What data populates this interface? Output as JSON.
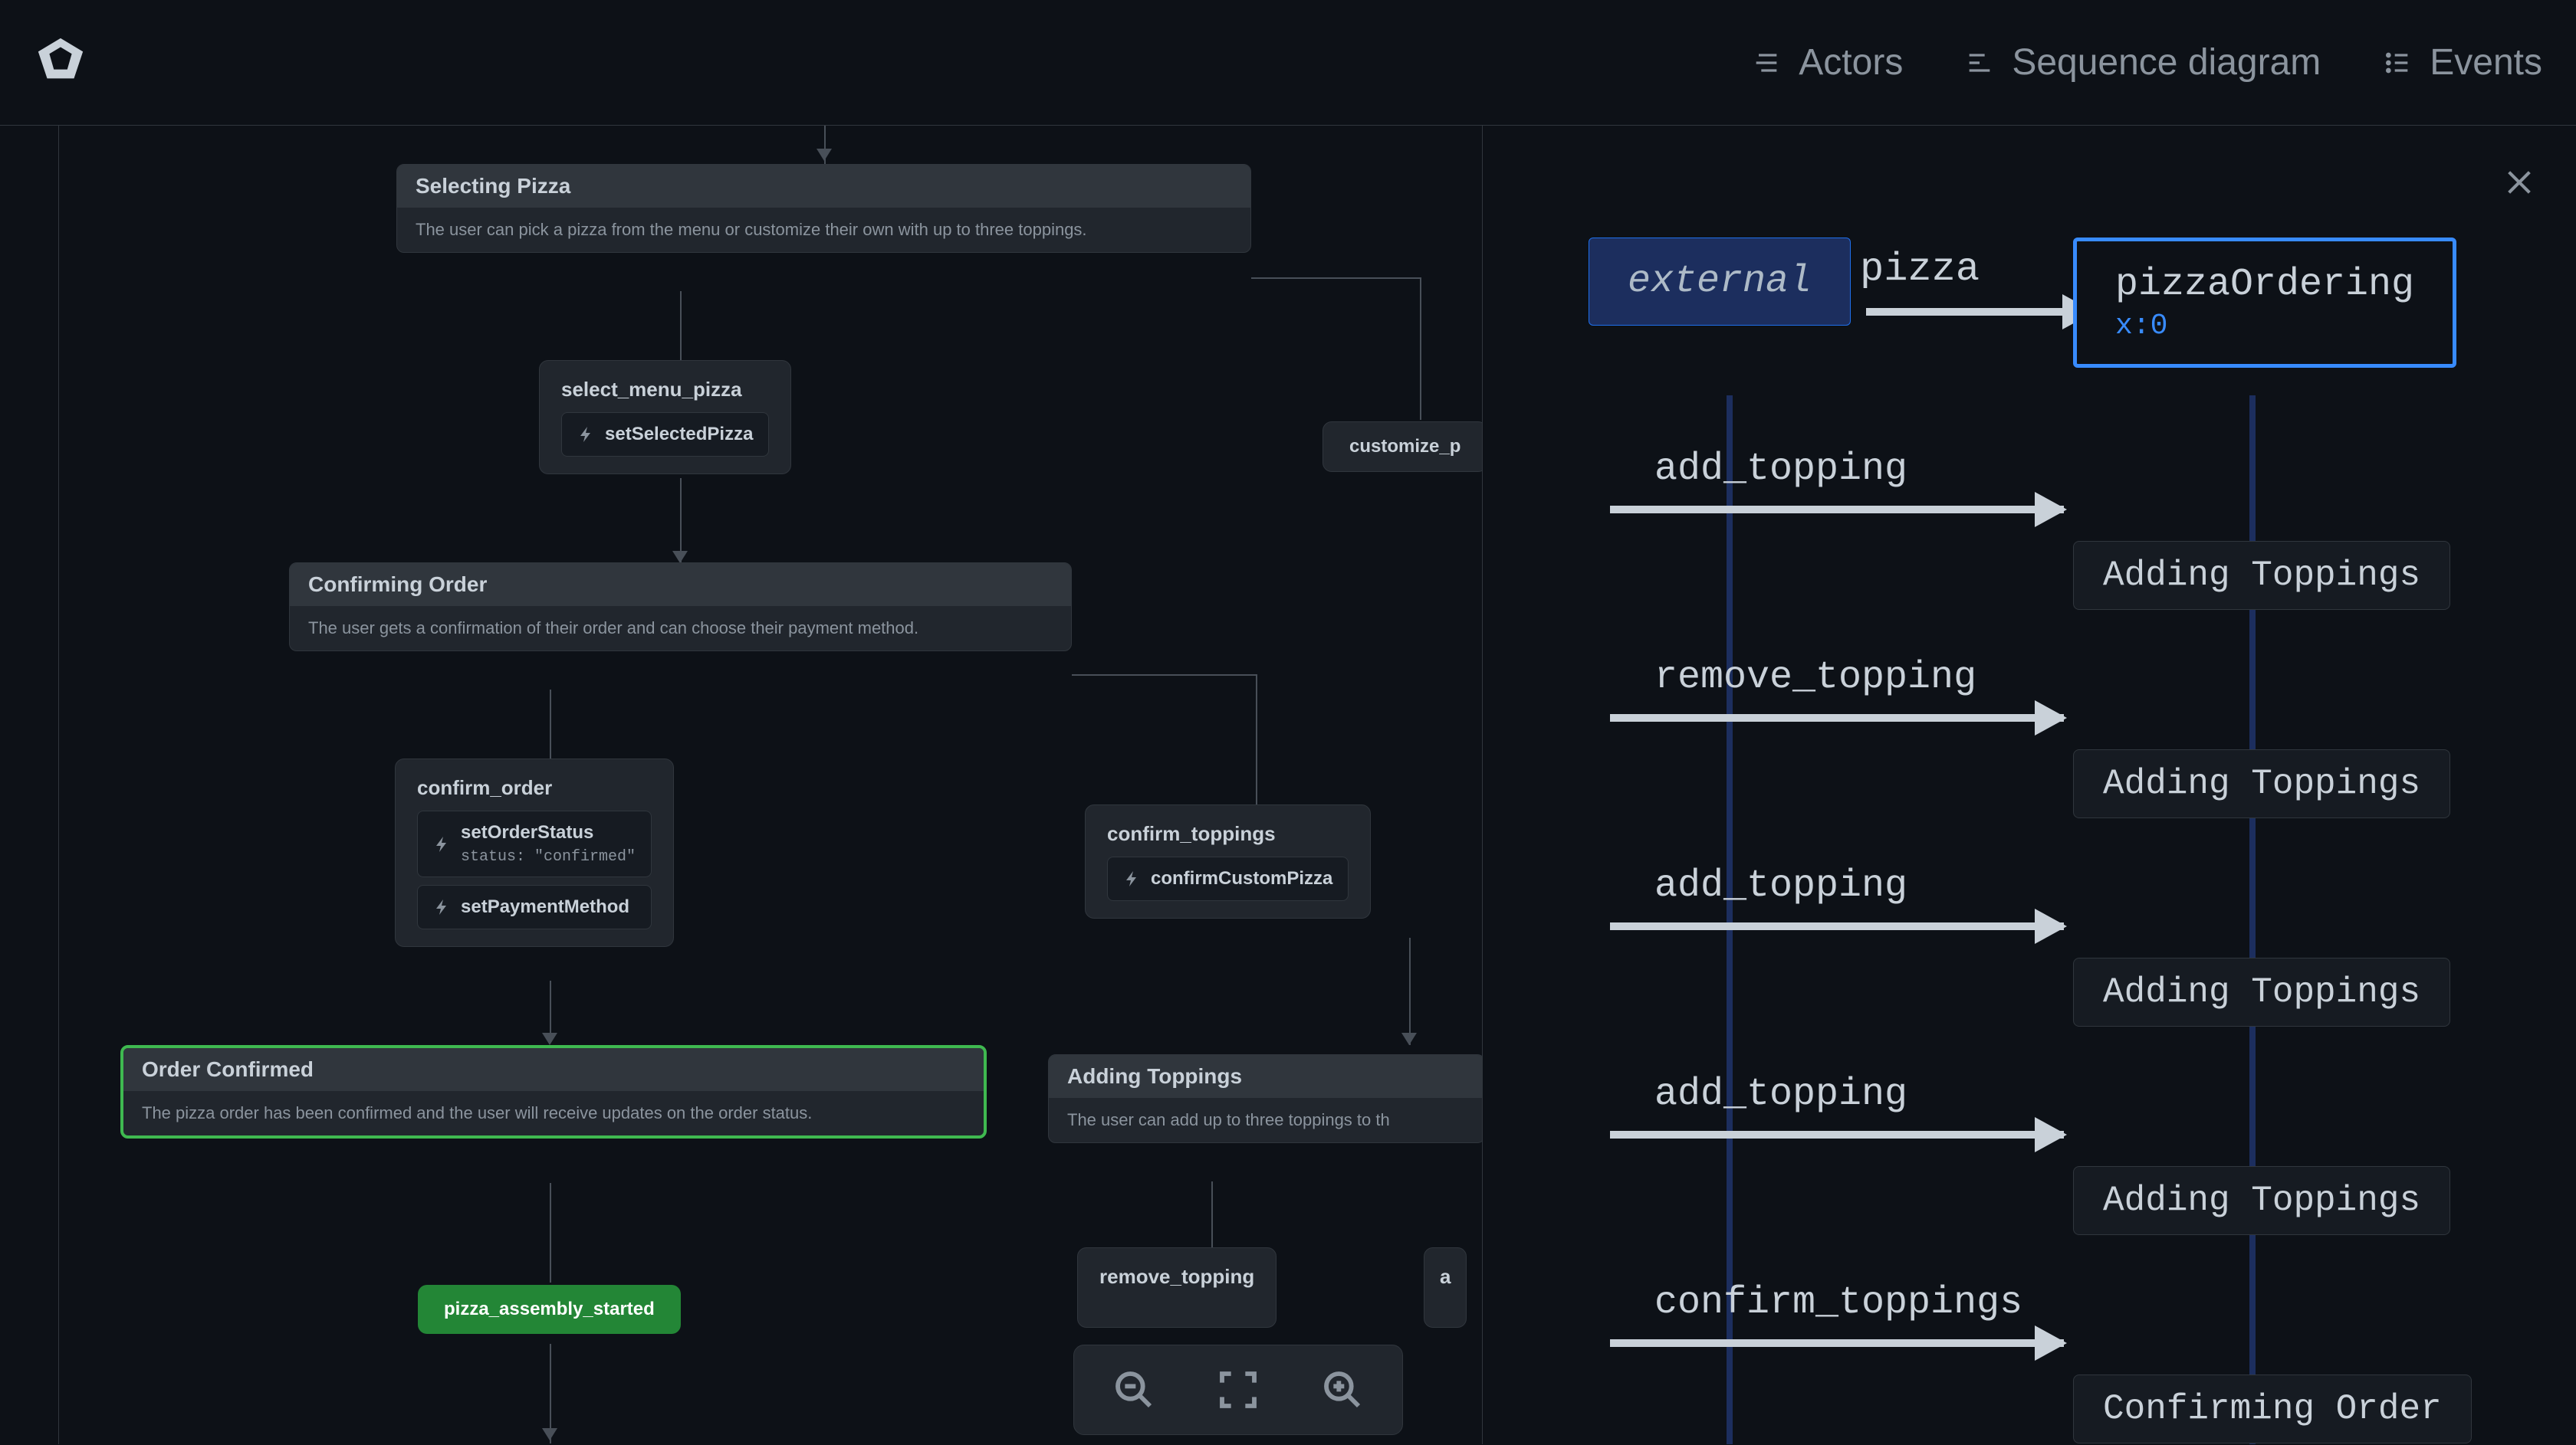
{
  "header": {
    "actors": "Actors",
    "sequence": "Sequence diagram",
    "events": "Events"
  },
  "canvas": {
    "selecting_pizza": {
      "title": "Selecting Pizza",
      "desc": "The user can pick a pizza from the menu or customize their own with up to three toppings."
    },
    "select_menu_pizza": {
      "title": "select_menu_pizza",
      "action": "setSelectedPizza"
    },
    "customize_pizza": "customize_p",
    "confirming_order": {
      "title": "Confirming Order",
      "desc": "The user gets a confirmation of their order and can choose their payment method."
    },
    "confirm_order": {
      "title": "confirm_order",
      "action1": "setOrderStatus",
      "action1_sub": "status: \"confirmed\"",
      "action2": "setPaymentMethod"
    },
    "confirm_toppings": {
      "title": "confirm_toppings",
      "action": "confirmCustomPizza"
    },
    "order_confirmed": {
      "title": "Order Confirmed",
      "desc": "The pizza order has been confirmed and the user will receive updates on the order status."
    },
    "adding_toppings": {
      "title": "Adding Toppings",
      "desc": "The user can add up to three toppings to th"
    },
    "remove_topping": "remove_topping",
    "add_prefix": "a",
    "pizza_assembly_started": "pizza_assembly_started"
  },
  "sequence": {
    "external": "external",
    "pizzaOrdering": "pizzaOrdering",
    "pizzaOrdering_sub": "x:0",
    "top_msg": "pizza",
    "events": [
      {
        "msg": "add_topping",
        "state": "Adding Toppings"
      },
      {
        "msg": "remove_topping",
        "state": "Adding Toppings"
      },
      {
        "msg": "add_topping",
        "state": "Adding Toppings"
      },
      {
        "msg": "add_topping",
        "state": "Adding Toppings"
      },
      {
        "msg": "confirm_toppings",
        "state": "Confirming Order"
      }
    ]
  }
}
